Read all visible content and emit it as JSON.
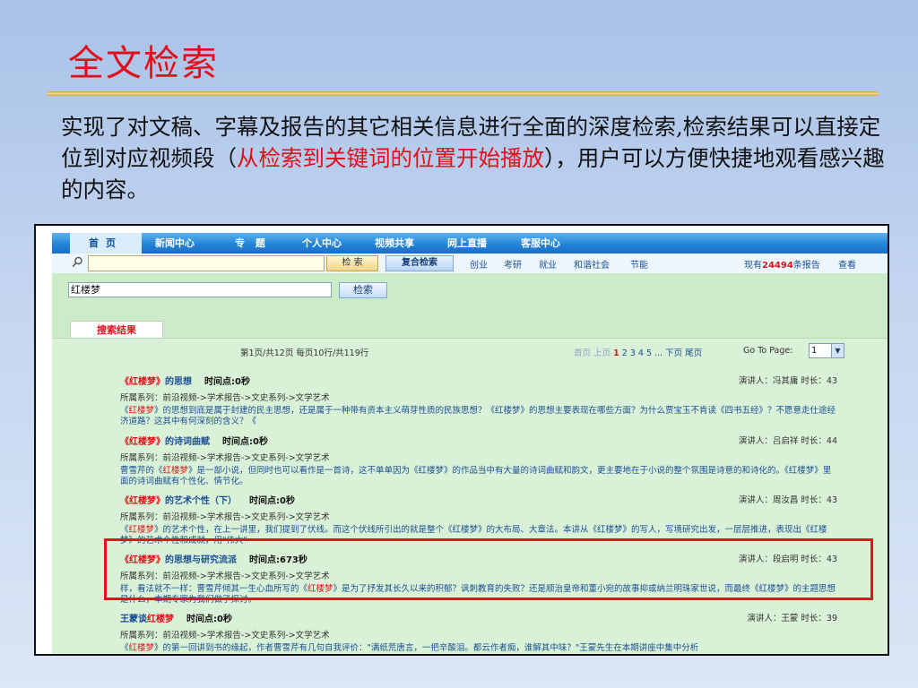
{
  "slide": {
    "title": "全文检索",
    "intro_a": "实现了对文稿、字幕及报告的其它相关信息进行全面的深度检索,检索结果可以直接定位到对应视频段（",
    "intro_highlight": "从检索到关键词的位置开始播放",
    "intro_b": "），用户可以方便快捷地观看感兴趣的内容。"
  },
  "nav": {
    "items": [
      "首页",
      "新闻中心",
      "专 题",
      "个人中心",
      "视频共享",
      "网上直播",
      "客服中心"
    ]
  },
  "toolbar": {
    "search_placeholder": "",
    "search_btn": "检 索",
    "advanced_btn": "复合检索",
    "categories": [
      "创业",
      "考研",
      "就业",
      "和谐社会",
      "节能"
    ],
    "report_prefix": "现有",
    "report_count": "24494",
    "report_suffix": "条报告",
    "view_link": "查看"
  },
  "search": {
    "keyword": "红楼梦",
    "button": "检索"
  },
  "tab": {
    "label": "搜索结果"
  },
  "pagination": {
    "info": "第1页/共12页  每页10行/共119行",
    "first": "首页",
    "prev": "上页",
    "current": "1",
    "pages": "2 3 4 5 ...",
    "next": "下页",
    "last": "尾页",
    "goto_label": "Go To Page:",
    "goto_value": "1"
  },
  "results": [
    {
      "kw": "《红楼梦》",
      "title_rest": "的思想",
      "time": "时间点:0秒",
      "speaker": "演讲人：冯其庸  时长：43",
      "series": "所属系列：前沿视频->学术报告->文史系列->文学艺术",
      "desc_a": "《",
      "desc_kw": "红楼梦",
      "desc_b": "》的思想到底是属于封建的民主思想，还是属于一种带有资本主义萌芽性质的民族思想？《红楼梦》的思想主要表现在哪些方面？为什么贾宝玉不肯读《四书五经》？不愿意走仕途经济道路？这其中有何深刻的含义？《"
    },
    {
      "kw": "《红楼梦》",
      "title_rest": "的诗词曲赋",
      "time": "时间点:0秒",
      "speaker": "演讲人：吕启祥  时长：44",
      "series": "所属系列：前沿视频->学术报告->文史系列->文学艺术",
      "desc_a": "曹雪芹的《",
      "desc_kw": "红楼梦",
      "desc_b": "》是一部小说，但同时也可以看作是一首诗，这不单单因为《红楼梦》的作品当中有大量的诗词曲赋和韵文，更主要地在于小说的整个氛围是诗意的和诗化的。《红楼梦》里面的诗词曲赋有个性化、情节化。"
    },
    {
      "kw": "《红楼梦》",
      "title_rest": "的艺术个性（下）",
      "time": "时间点:0秒",
      "speaker": "演讲人：周汝昌  时长：43",
      "series": "所属系列：前沿视频->学术报告->文史系列->文学艺术",
      "desc_a": "《",
      "desc_kw": "红楼梦",
      "desc_b": "》的艺术个性，在上一讲里，我们提到了伏线。而这个伏线所引出的就是整个《红楼梦》的大布局、大章法。本讲从《红楼梦》的写人，写境研究出发，一层层推进，表现出《红楼梦》的艺术个性和成就，用\"伟大\""
    },
    {
      "kw": "《红楼梦》",
      "title_rest": "的思想与研究流派",
      "time": "时间点:673秒",
      "speaker": "演讲人：段启明  时长：43",
      "series": "所属系列：前沿视频->学术报告->文史系列->文学艺术",
      "desc_a": "样，看法就不一样：曹雪芹倾其一生心血所写的《",
      "desc_kw": "红楼梦",
      "desc_b": "》是为了抒发其长久以来的积郁？讽刺教育的失败？还是顺治皇帝和董小宛的故事抑或纳兰明珠家世说，而最终《红楼梦》的主题思想是什么，本期专家为我们做了探讨。"
    },
    {
      "kw": "王蒙谈",
      "title_rest": "红楼梦",
      "time": "时间点:0秒",
      "speaker": "演讲人：王蒙  时长：39",
      "series": "所属系列：前沿视频->学术报告->文史系列->文学艺术",
      "desc_a": "《",
      "desc_kw": "红楼梦",
      "desc_b": "》的第一回讲到书的缘起，作者曹雪芹有几句自我评价：\"满纸荒唐言，一把辛酸泪。都云作者痴，谁解其中味？\"王蒙先生在本期讲座中集中分析"
    }
  ]
}
